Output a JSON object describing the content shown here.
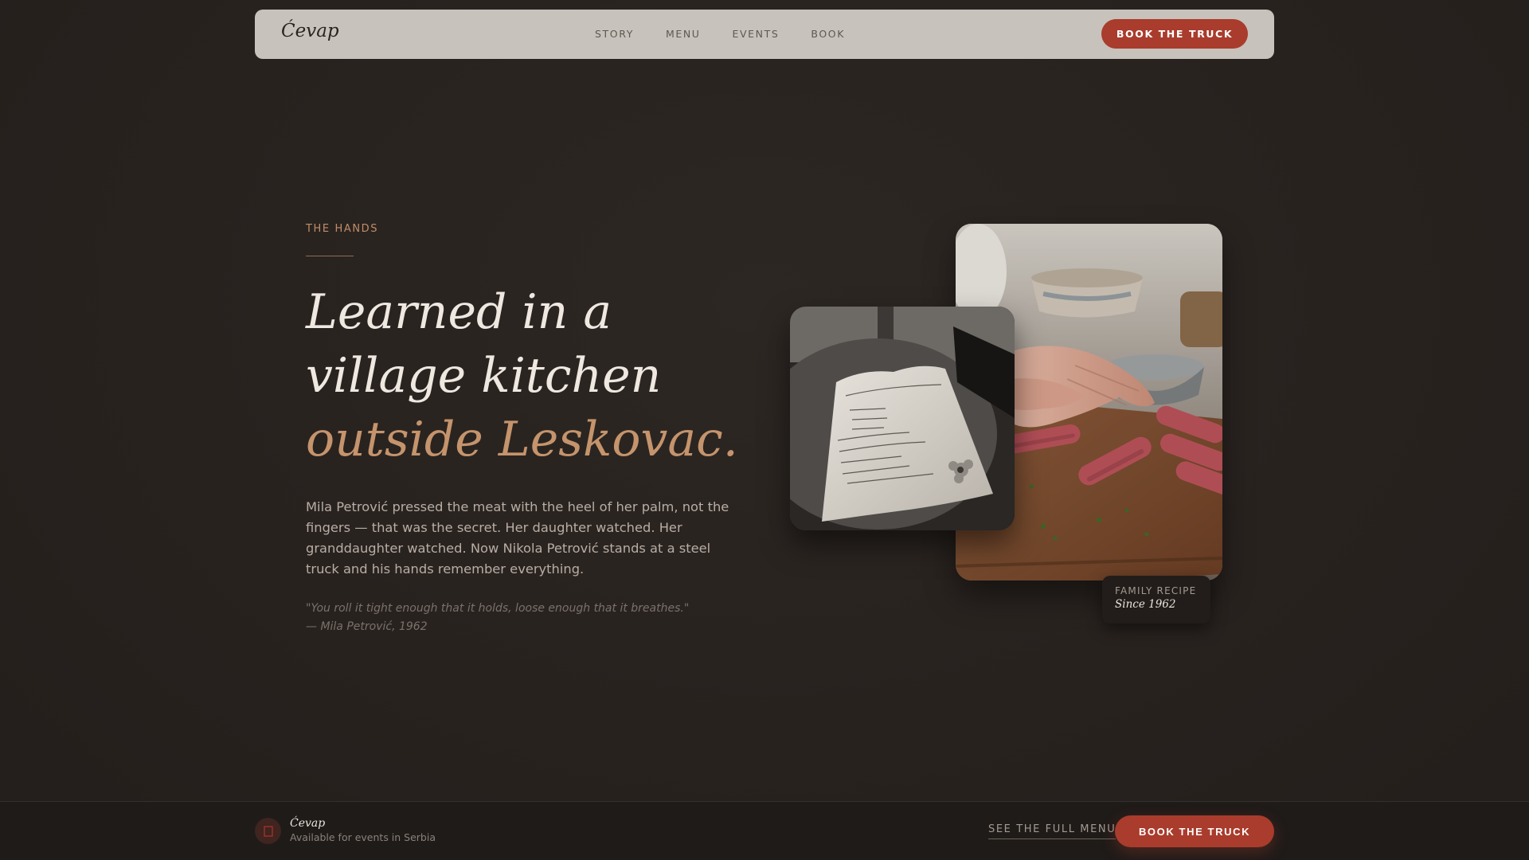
{
  "nav": {
    "brand": "Ćevap",
    "links": [
      "STORY",
      "MENU",
      "EVENTS",
      "BOOK"
    ],
    "cta_label": "BOOK THE TRUCK"
  },
  "hero": {
    "eyebrow": "THE HANDS",
    "headline_line1": "Learned in a",
    "headline_line2": "village kitchen",
    "headline_line3": "outside Leskovac.",
    "body": "Mila Petrović pressed the meat with the heel of her palm, not the fingers — that was the secret. Her daughter watched. Her granddaughter watched. Now Nikola Petrović stands at a steel truck and his hands remember everything.",
    "quote_line1": "\"You roll it tight enough that it holds, loose enough that it breathes.\"",
    "quote_line2": "— Mila Petrović, 1962"
  },
  "badge": {
    "label": "FAMILY RECIPE",
    "value": "Since 1962"
  },
  "footer": {
    "brand": "Ćevap",
    "subtitle": "Available for events in Serbia",
    "link_label": "SEE THE FULL MENU",
    "cta_label": "BOOK THE TRUCK"
  },
  "colors": {
    "background": "#2b2521",
    "nav_background": "#c7c2bb",
    "accent_red": "#a93c2c",
    "accent_copper": "#c5946c"
  },
  "icons": {
    "footer_badge": "flame-icon"
  }
}
